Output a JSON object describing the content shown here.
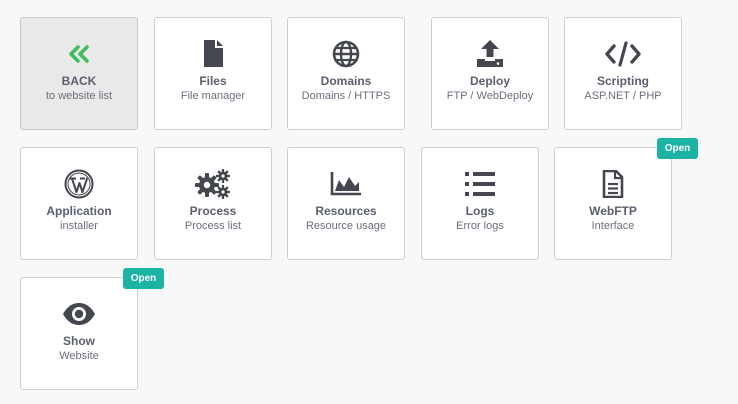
{
  "tiles": {
    "back": {
      "title": "BACK",
      "subtitle": "to website list",
      "icon": "double-chevron-left-icon",
      "icon_color": "#3ebd5f"
    },
    "files": {
      "title": "Files",
      "subtitle": "File manager",
      "icon": "file-icon"
    },
    "domains": {
      "title": "Domains",
      "subtitle": "Domains / HTTPS",
      "icon": "globe-icon"
    },
    "deploy": {
      "title": "Deploy",
      "subtitle": "FTP / WebDeploy",
      "icon": "upload-icon"
    },
    "scripting": {
      "title": "Scripting",
      "subtitle": "ASP.NET / PHP",
      "icon": "code-icon"
    },
    "application": {
      "title": "Application",
      "subtitle": "installer",
      "icon": "wordpress-icon"
    },
    "process": {
      "title": "Process",
      "subtitle": "Process list",
      "icon": "gears-icon"
    },
    "resources": {
      "title": "Resources",
      "subtitle": "Resource usage",
      "icon": "area-chart-icon"
    },
    "logs": {
      "title": "Logs",
      "subtitle": "Error logs",
      "icon": "list-icon"
    },
    "webftp": {
      "title": "WebFTP",
      "subtitle": "Interface",
      "icon": "document-icon",
      "badge": "Open"
    },
    "show": {
      "title": "Show",
      "subtitle": "Website",
      "icon": "eye-icon",
      "badge": "Open"
    }
  },
  "colors": {
    "icon": "#44474f",
    "accent": "#3ebd5f",
    "badge": "#1bb3a4",
    "title": "#5b5f6e"
  }
}
